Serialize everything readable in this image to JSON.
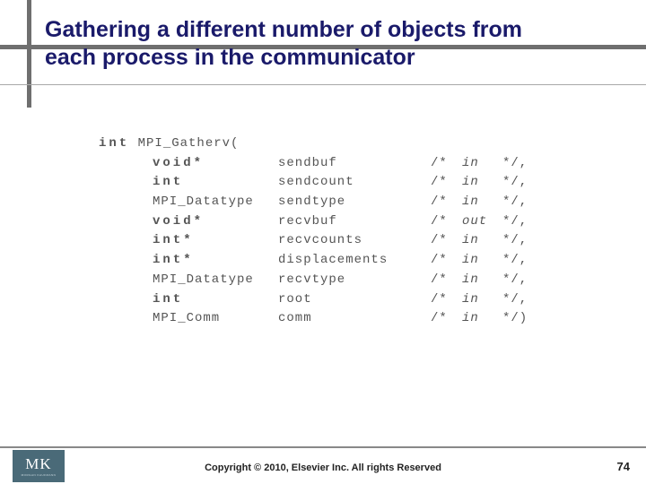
{
  "title_line1": "Gathering a different number of objects from",
  "title_line2": "each process in the communicator",
  "func_decl_prefix": "int",
  "func_name": "MPI_Gatherv(",
  "params": [
    {
      "type": "void*",
      "type_bold": true,
      "name": "sendbuf",
      "dir": "in",
      "term": "*/,"
    },
    {
      "type": "int",
      "type_bold": true,
      "name": "sendcount",
      "dir": "in",
      "term": "*/,"
    },
    {
      "type": "MPI_Datatype",
      "type_bold": false,
      "name": "sendtype",
      "dir": "in",
      "term": "*/,"
    },
    {
      "type": "void*",
      "type_bold": true,
      "name": "recvbuf",
      "dir": "out",
      "term": "*/,"
    },
    {
      "type": "int*",
      "type_bold": true,
      "name": "recvcounts",
      "dir": "in",
      "term": "*/,"
    },
    {
      "type": "int*",
      "type_bold": true,
      "name": "displacements",
      "dir": "in",
      "term": "*/,"
    },
    {
      "type": "MPI_Datatype",
      "type_bold": false,
      "name": "recvtype",
      "dir": "in",
      "term": "*/,"
    },
    {
      "type": "int",
      "type_bold": true,
      "name": "root",
      "dir": "in",
      "term": "*/,"
    },
    {
      "type": "MPI_Comm",
      "type_bold": false,
      "name": "comm",
      "dir": "in",
      "term": "*/)"
    }
  ],
  "comment_open": "/*",
  "copyright": "Copyright © 2010, Elsevier Inc. All rights Reserved",
  "page_number": "74",
  "logo_text": "MK",
  "logo_sub": "MORGAN KAUFMANN"
}
